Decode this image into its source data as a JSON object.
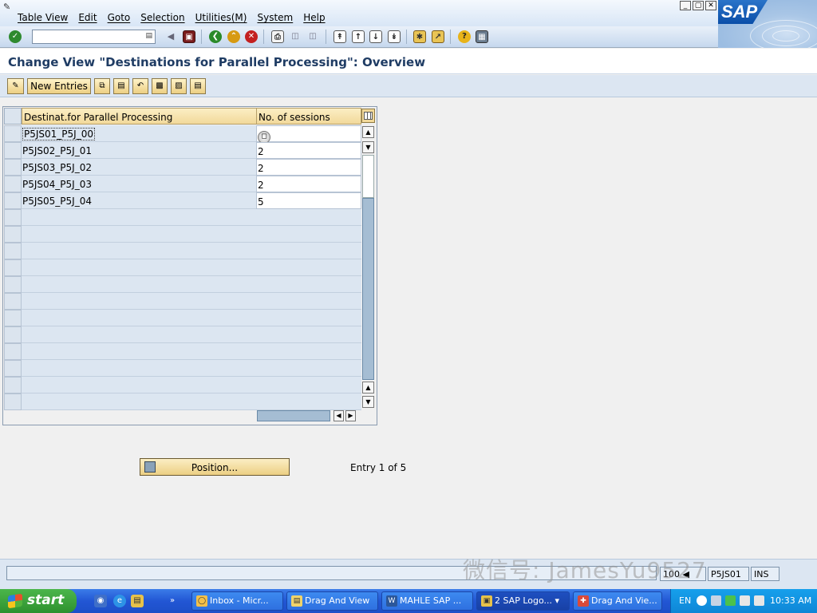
{
  "menu": {
    "items": [
      "Table View",
      "Edit",
      "Goto",
      "Selection",
      "Utilities(M)",
      "System",
      "Help"
    ]
  },
  "window_controls": [
    "minimize-icon",
    "restore-icon",
    "close-icon"
  ],
  "logo": {
    "text": "SAP"
  },
  "toolbar": {
    "command_field_value": "",
    "icons": [
      "enter-icon",
      "back-arrow-icon",
      "save-icon",
      "back-icon",
      "exit-icon",
      "cancel-icon",
      "print-icon",
      "find-icon",
      "find-next-icon",
      "first-page-icon",
      "previous-page-icon",
      "next-page-icon",
      "last-page-icon",
      "new-session-icon",
      "shortcut-icon",
      "help-icon",
      "layout-menu-icon"
    ]
  },
  "title": "Change View \"Destinations for Parallel Processing\": Overview",
  "app_toolbar": {
    "new_entries_label": "New Entries",
    "icons": [
      "display-change-icon",
      "copy-as-icon",
      "delete-icon",
      "undo-change-icon",
      "select-all-icon",
      "select-block-icon",
      "deselect-all-icon"
    ]
  },
  "table": {
    "headers": [
      "Destinat.for Parallel Processing",
      "No. of sessions"
    ],
    "rows": [
      {
        "destination": "P5JS01_P5J_00",
        "sessions": ""
      },
      {
        "destination": "P5JS02_P5J_01",
        "sessions": "2"
      },
      {
        "destination": "P5JS03_P5J_02",
        "sessions": "2"
      },
      {
        "destination": "P5JS04_P5J_03",
        "sessions": "2"
      },
      {
        "destination": "P5JS05_P5J_04",
        "sessions": "5"
      }
    ],
    "empty_rows": 12
  },
  "position_button_label": "Position...",
  "entry_info": "Entry 1 of 5",
  "status": {
    "client": "100",
    "server": "P5JS01",
    "mode": "INS"
  },
  "watermark": "微信号: JamesYu9527",
  "taskbar": {
    "start_label": "start",
    "tasks": [
      "Inbox - Micr...",
      "Drag And View",
      "MAHLE SAP ...",
      "2 SAP Logo...",
      "Drag And Vie..."
    ],
    "language": "EN",
    "clock": "10:33 AM"
  },
  "colors": {
    "title_text": "#1f3c64",
    "header_gold": "#f2d99a",
    "table_row": "#dce6f1",
    "taskbar_blue": "#2256d4",
    "start_green": "#3a9d3a"
  }
}
